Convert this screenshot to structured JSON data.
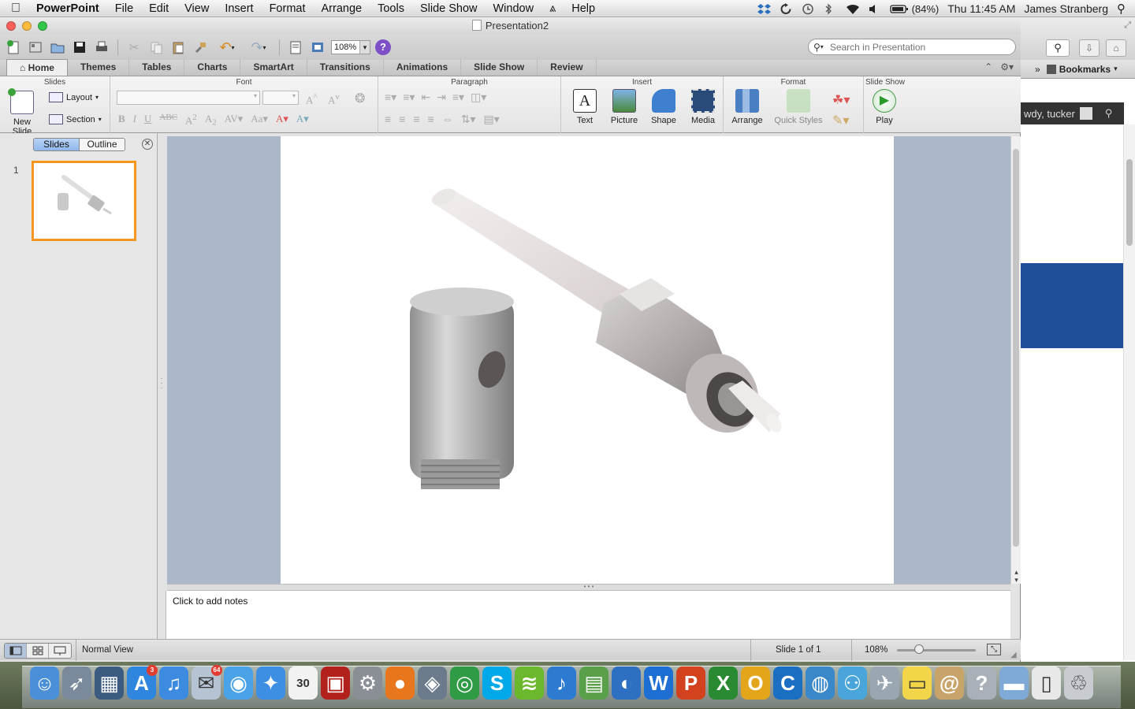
{
  "menubar": {
    "app": "PowerPoint",
    "items": [
      "File",
      "Edit",
      "View",
      "Insert",
      "Format",
      "Arrange",
      "Tools",
      "Slide Show",
      "Window",
      "Help"
    ],
    "battery": "(84%)",
    "clock": "Thu 11:45 AM",
    "user": "James Stranberg"
  },
  "window": {
    "title": "Presentation2"
  },
  "toolbar": {
    "zoom": "108%",
    "search_placeholder": "Search in Presentation"
  },
  "ribbon_tabs": [
    "Home",
    "Themes",
    "Tables",
    "Charts",
    "SmartArt",
    "Transitions",
    "Animations",
    "Slide Show",
    "Review"
  ],
  "ribbon": {
    "groups": {
      "slides": "Slides",
      "font": "Font",
      "paragraph": "Paragraph",
      "insert": "Insert",
      "format": "Format",
      "slideshow": "Slide Show"
    },
    "new_slide": "New Slide",
    "layout": "Layout",
    "section": "Section",
    "text": "Text",
    "picture": "Picture",
    "shape": "Shape",
    "media": "Media",
    "arrange": "Arrange",
    "quick_styles": "Quick Styles",
    "play": "Play"
  },
  "panel": {
    "tab_slides": "Slides",
    "tab_outline": "Outline",
    "slide_number": "1"
  },
  "notes": {
    "placeholder": "Click to add notes"
  },
  "status": {
    "view": "Normal View",
    "slide_count": "Slide 1 of 1",
    "zoom": "108%"
  },
  "browser_bg": {
    "bookmarks": "Bookmarks",
    "greeting": "wdy, tucker"
  },
  "dock": {
    "items": [
      {
        "name": "finder-icon",
        "color": "#4a8fd8",
        "glyph": "☺"
      },
      {
        "name": "launchpad-icon",
        "color": "#7a8a9c",
        "glyph": "➶"
      },
      {
        "name": "mission-control-icon",
        "color": "#3b5b80",
        "glyph": "▦"
      },
      {
        "name": "app-store-icon",
        "color": "#2e86de",
        "glyph": "A",
        "badge": "3"
      },
      {
        "name": "itunes-icon",
        "color": "#3c8be0",
        "glyph": "♫"
      },
      {
        "name": "mail-stamp-icon",
        "color": "#b5c3d3",
        "glyph": "✉",
        "badge": "64"
      },
      {
        "name": "facetime-chat-icon",
        "color": "#4aa3e6",
        "glyph": "◉"
      },
      {
        "name": "safari-icon",
        "color": "#3d8fe3",
        "glyph": "✦"
      },
      {
        "name": "calendar-icon",
        "color": "#f2f2f2",
        "glyph": "30"
      },
      {
        "name": "photo-booth-icon",
        "color": "#b2211c",
        "glyph": "▣"
      },
      {
        "name": "system-preferences-icon",
        "color": "#8a8f96",
        "glyph": "⚙"
      },
      {
        "name": "firefox-icon",
        "color": "#e8761d",
        "glyph": "●"
      },
      {
        "name": "iphoto-icon",
        "color": "#6b7b8c",
        "glyph": "◈"
      },
      {
        "name": "chrome-icon",
        "color": "#2f9b44",
        "glyph": "◎"
      },
      {
        "name": "skype-icon",
        "color": "#00a8e8",
        "glyph": "S"
      },
      {
        "name": "spotify-icon",
        "color": "#6cb82d",
        "glyph": "≋"
      },
      {
        "name": "itunes-radio-icon",
        "color": "#2c7bd0",
        "glyph": "♪"
      },
      {
        "name": "preview-icon",
        "color": "#5a9f4a",
        "glyph": "▤"
      },
      {
        "name": "outlook-icon",
        "color": "#2d6fc0",
        "glyph": "◐"
      },
      {
        "name": "word-icon",
        "color": "#1e6fd3",
        "glyph": "W"
      },
      {
        "name": "powerpoint-icon",
        "color": "#d2421f",
        "glyph": "P"
      },
      {
        "name": "excel-icon",
        "color": "#2a8a32",
        "glyph": "X"
      },
      {
        "name": "onenote-icon",
        "color": "#e3a51a",
        "glyph": "O"
      },
      {
        "name": "lync-icon",
        "color": "#1a6fc2",
        "glyph": "C"
      },
      {
        "name": "downloads-globe-icon",
        "color": "#3a87c9",
        "glyph": "◍"
      },
      {
        "name": "messenger-icon",
        "color": "#4aa5db",
        "glyph": "⚇"
      },
      {
        "name": "network-utility-icon",
        "color": "#9aa6b2",
        "glyph": "✈"
      },
      {
        "name": "stickies-icon",
        "color": "#f3d54a",
        "glyph": "▭"
      },
      {
        "name": "contacts-icon",
        "color": "#c9a46a",
        "glyph": "@"
      },
      {
        "name": "help-viewer-icon",
        "color": "#aab0b8",
        "glyph": "?"
      },
      {
        "name": "applications-folder-icon",
        "color": "#7fa9d6",
        "glyph": "▬"
      },
      {
        "name": "document-stack-icon",
        "color": "#e8e8e8",
        "glyph": "▯"
      },
      {
        "name": "trash-icon",
        "color": "#c8ccd0",
        "glyph": "♲"
      }
    ]
  }
}
